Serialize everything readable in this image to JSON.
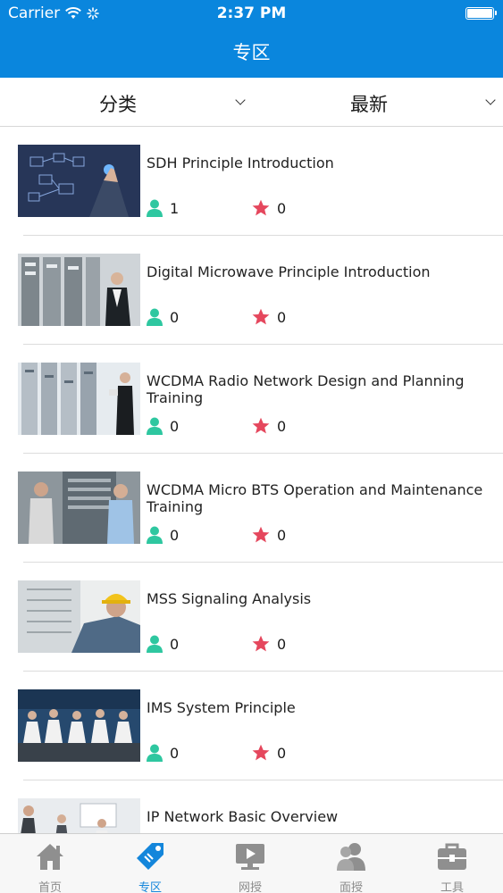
{
  "status_bar": {
    "carrier": "Carrier",
    "time": "2:37 PM"
  },
  "nav": {
    "title": "专区"
  },
  "filters": {
    "category_label": "分类",
    "sort_label": "最新"
  },
  "courses": [
    {
      "title": "SDH Principle Introduction",
      "learners": "1",
      "favorites": "0"
    },
    {
      "title": "Digital Microwave Principle Introduction",
      "learners": "0",
      "favorites": "0"
    },
    {
      "title": "WCDMA Radio Network Design and Planning Training",
      "learners": "0",
      "favorites": "0"
    },
    {
      "title": "WCDMA Micro BTS Operation and Maintenance Training",
      "learners": "0",
      "favorites": "0"
    },
    {
      "title": "MSS Signaling Analysis",
      "learners": "0",
      "favorites": "0"
    },
    {
      "title": "IMS System Principle",
      "learners": "0",
      "favorites": "0"
    },
    {
      "title": "IP Network Basic Overview",
      "learners": "",
      "favorites": ""
    }
  ],
  "tabs": [
    {
      "label": "首页",
      "icon": "home-icon"
    },
    {
      "label": "专区",
      "icon": "tag-icon"
    },
    {
      "label": "网授",
      "icon": "video-icon"
    },
    {
      "label": "面授",
      "icon": "people-icon"
    },
    {
      "label": "工具",
      "icon": "toolbox-icon"
    }
  ],
  "colors": {
    "header": "#0a86dd",
    "active_tab": "#1486db",
    "inactive_tab": "#8a8a8a",
    "person_icon": "#2ec7a0",
    "star_icon": "#e5475d"
  }
}
